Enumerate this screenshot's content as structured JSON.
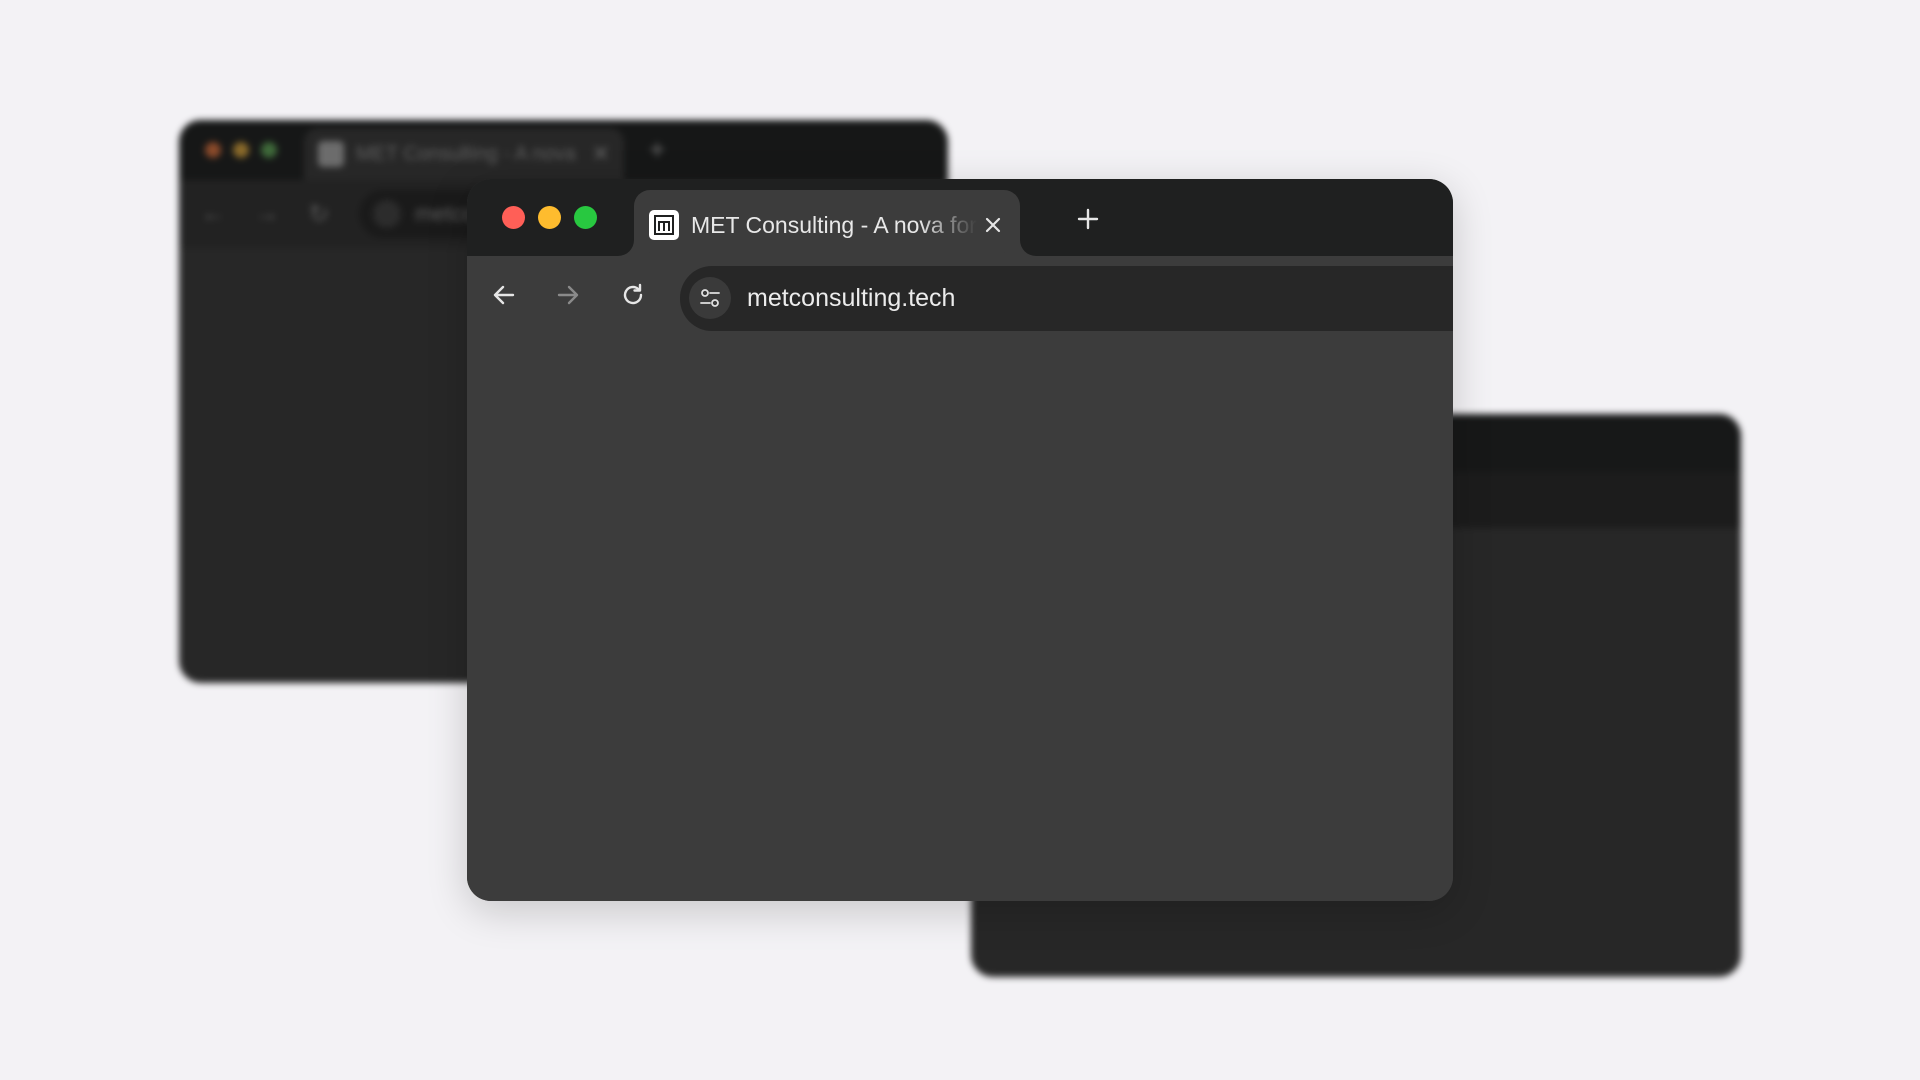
{
  "colors": {
    "page_background": "#f3f2f5",
    "window_background": "#3c3c3c",
    "tabstrip_background": "#1f2020",
    "omnibox_background": "#272727",
    "traffic_close": "#ff5f57",
    "traffic_minimize": "#febc2e",
    "traffic_zoom": "#28c840"
  },
  "main_window": {
    "tab": {
      "favicon": "met-logo-icon",
      "title": "MET Consulting - A nova forma de consultoria",
      "close_icon": "close-icon"
    },
    "new_tab_icon": "plus-icon",
    "toolbar": {
      "back_icon": "arrow-left-icon",
      "forward_icon": "arrow-right-icon",
      "reload_icon": "reload-icon",
      "site_settings_icon": "tune-icon",
      "url": "metconsulting.tech"
    }
  },
  "background_windows": {
    "back_left": {
      "tab_title": "MET Consulting - A nova fo",
      "url": "metcon"
    }
  }
}
